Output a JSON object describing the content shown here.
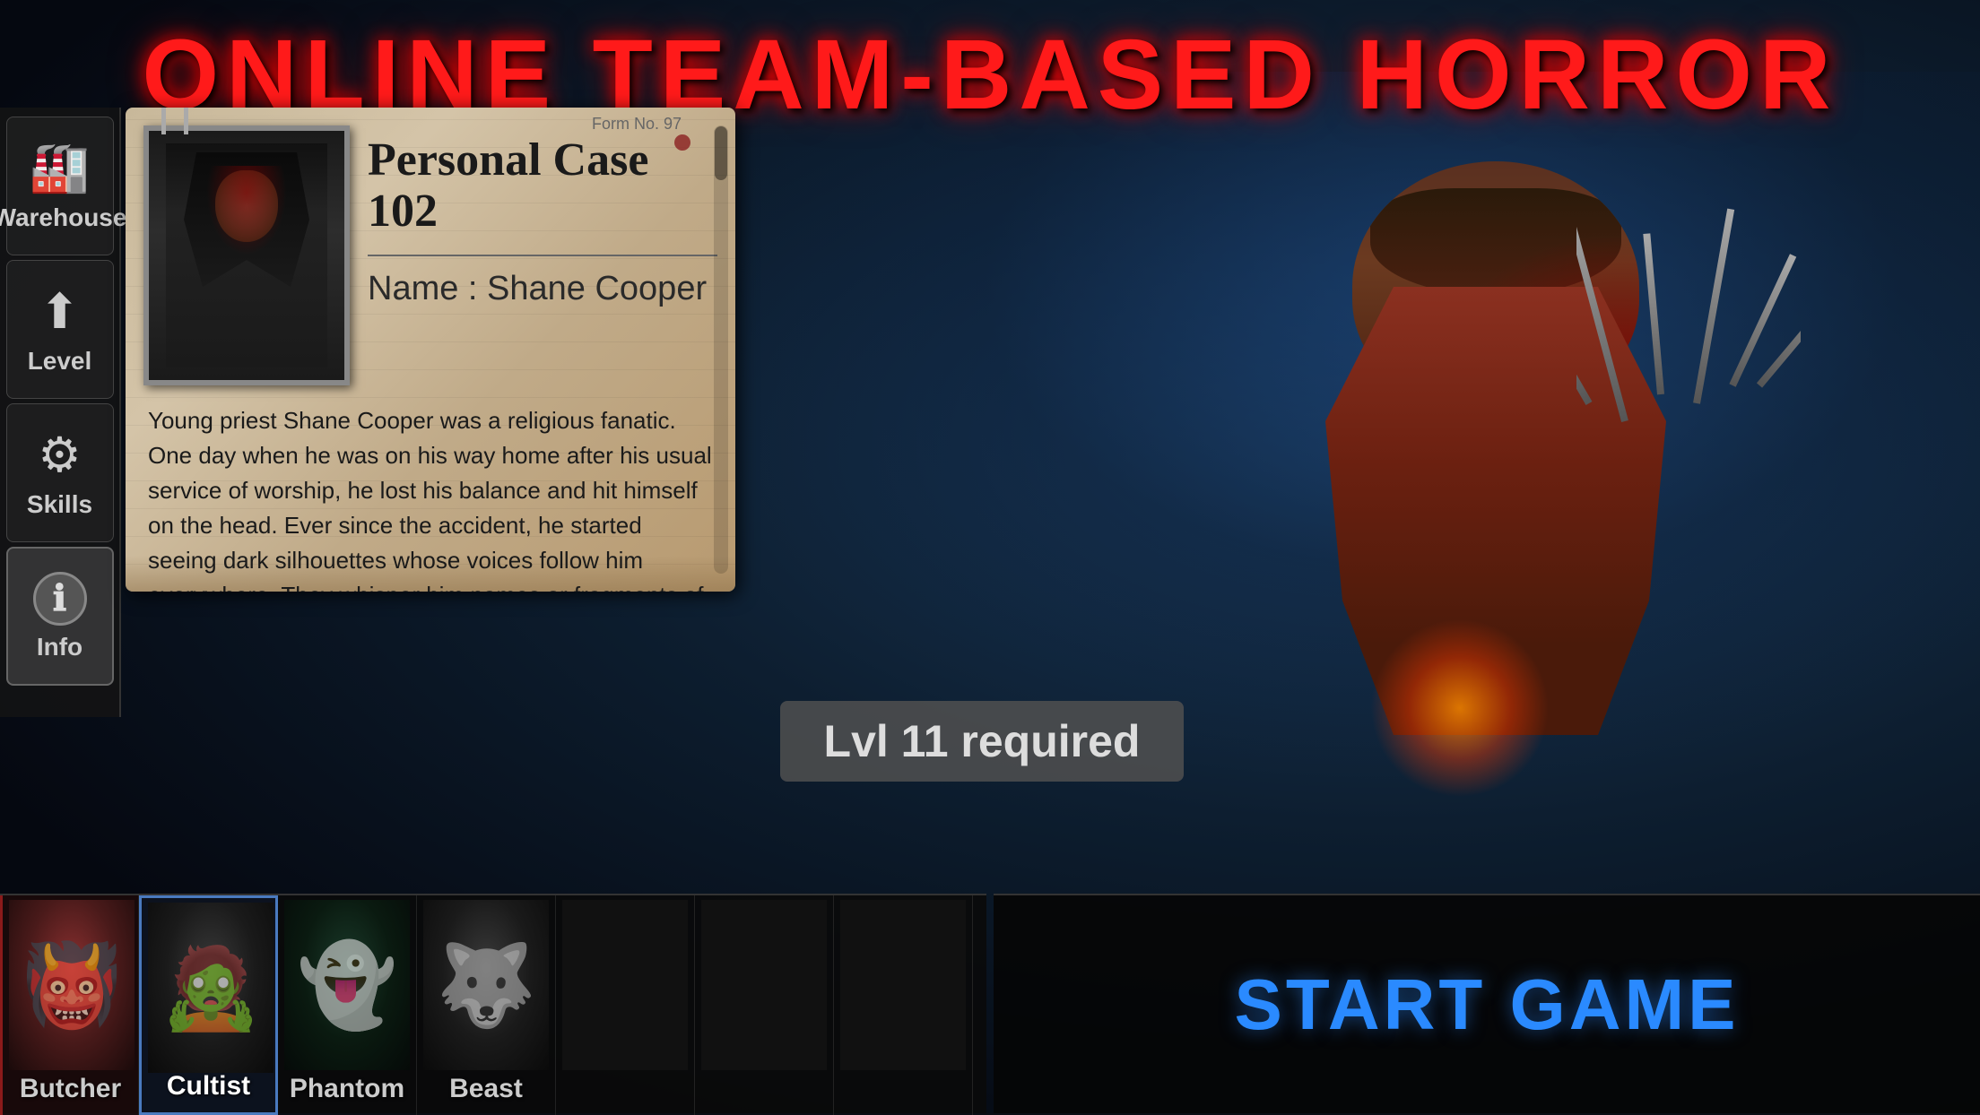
{
  "title": "ONLINE TEAM-BASED HORROR",
  "sidebar": {
    "items": [
      {
        "id": "warehouse",
        "label": "Warehouse",
        "icon": "🏭",
        "active": false
      },
      {
        "id": "level",
        "label": "Level",
        "icon": "⬆",
        "active": false
      },
      {
        "id": "skills",
        "label": "Skills",
        "icon": "⚙",
        "active": false
      },
      {
        "id": "info",
        "label": "Info",
        "icon": "ℹ",
        "active": true
      }
    ]
  },
  "case_card": {
    "case_number": "Personal Case 102",
    "form_no": "Form No. 97",
    "name_label": "Name : Shane Cooper",
    "description": "Young priest Shane Cooper was a religious fanatic. One day when he was on his way home after his usual service of worship, he lost his balance and hit himself on the head. Ever since the accident, he started seeing dark silhouettes whose voices follow him everywhere. They whisper him names or fragments of names. Nobody knows for sure whether these entities appeared as a result of his head injury or if they are some kind of demonic force that possessed his consciousness. In the end, the \"dark..."
  },
  "level_required": {
    "text": "Lvl 11 required"
  },
  "characters": [
    {
      "id": "butcher",
      "label": "Butcher",
      "selected": false,
      "first": true
    },
    {
      "id": "cultist",
      "label": "Cultist",
      "selected": true,
      "first": false
    },
    {
      "id": "phantom",
      "label": "Phantom",
      "selected": false,
      "first": false
    },
    {
      "id": "beast",
      "label": "Beast",
      "selected": false,
      "first": false
    },
    {
      "id": "empty1",
      "label": "",
      "selected": false,
      "first": false
    },
    {
      "id": "empty2",
      "label": "",
      "selected": false,
      "first": false
    },
    {
      "id": "empty3",
      "label": "",
      "selected": false,
      "first": false
    }
  ],
  "start_button": {
    "label": "START GAME"
  }
}
